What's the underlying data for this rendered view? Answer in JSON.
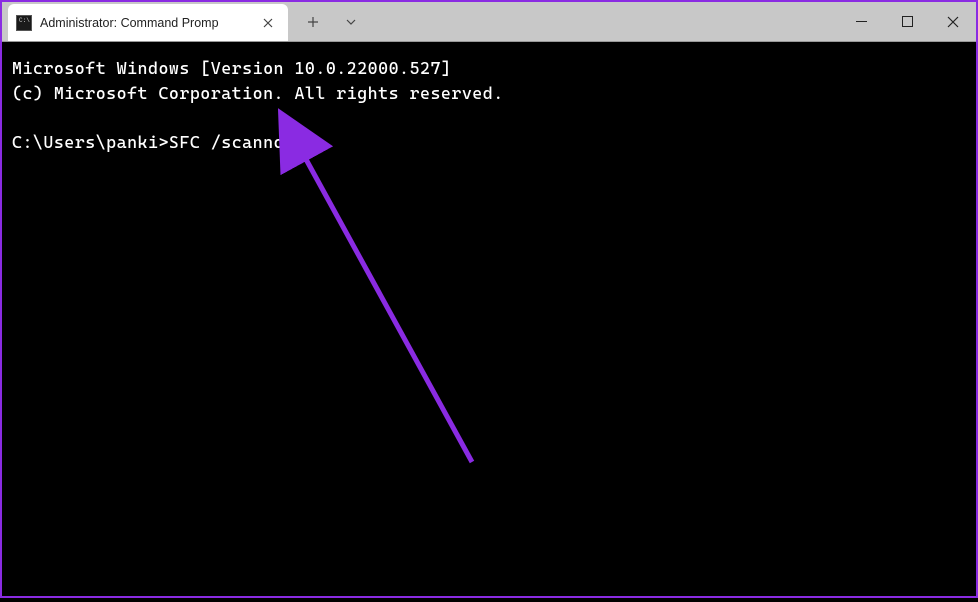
{
  "tab": {
    "title": "Administrator: Command Promp",
    "icon_name": "cmd-icon"
  },
  "terminal": {
    "line1": "Microsoft Windows [Version 10.0.22000.527]",
    "line2": "(c) Microsoft Corporation. All rights reserved.",
    "prompt": "C:\\Users\\panki>",
    "command": "SFC /scannow"
  }
}
